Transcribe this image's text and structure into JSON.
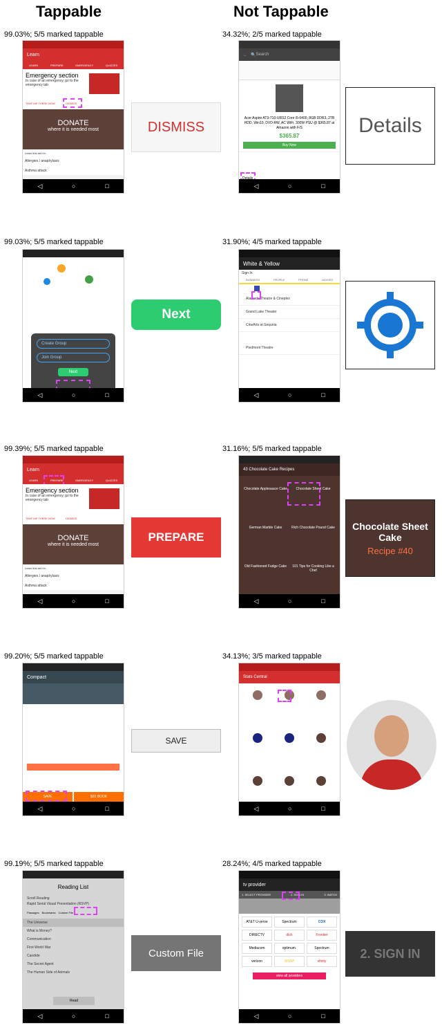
{
  "headers": {
    "tappable": "Tappable",
    "not_tappable": "Not Tappable"
  },
  "rows": [
    {
      "left_caption": "99.03%; 5/5 marked tappable",
      "left_crop": "DISMISS",
      "right_caption": "34.32%; 2/5 marked tappable",
      "right_crop": "Details"
    },
    {
      "left_caption": "99.03%; 5/5 marked tappable",
      "left_crop": "Next",
      "right_caption": "31.90%; 4/5 marked tappable",
      "right_crop": ""
    },
    {
      "left_caption": "99.39%; 5/5 marked tappable",
      "left_crop": "PREPARE",
      "right_caption": "31.16%; 5/5 marked tappable",
      "right_crop_title": "Chocolate Sheet Cake",
      "right_crop_sub": "Recipe #40"
    },
    {
      "left_caption": "99.20%; 5/5 marked tappable",
      "left_crop": "SAVE",
      "right_caption": "34.13%; 3/5 marked tappable",
      "right_crop": ""
    },
    {
      "left_caption": "99.19%; 5/5 marked tappable",
      "left_crop": "Custom File",
      "right_caption": "28.24%; 4/5 marked tappable",
      "right_crop": "2. SIGN IN"
    }
  ],
  "screens": {
    "learn_title": "Learn",
    "learn_tabs": [
      "LEARN",
      "PREPARE",
      "EMERGENCY",
      "QUIZZES"
    ],
    "emergency_section": "Emergency section",
    "emergency_text": "In case of an emergency, go to the emergency tab",
    "take_me": "TAKE ME THERE NOW",
    "dismiss": "DISMISS",
    "donate": "DONATE",
    "donate_sub": "where it is needed most",
    "learn_first_aid": "Learn first aid for...",
    "allergies": "Allergies / anaphylaxis",
    "asthma": "Asthma attack",
    "search": "Search",
    "product_title": "Acer Aspire AT3-710-URS2 Core i5-6400, 8GB DDR3, 2TB HDD, Win10, DVD-RW, AC WiFi, 300W PSU @ $365.87 at Amazon with F/S",
    "price": "$365.87",
    "buy_now": "Buy Now",
    "details": "Details",
    "create_group": "Create Group",
    "join_group": "Join Group",
    "next": "Next",
    "white_yellow": "White & Yellow",
    "sign_in": "Sign In",
    "yp_tabs": [
      "BUSINESS",
      "PEOPLE",
      "PHONE",
      "MOVIES"
    ],
    "theaters": [
      "Alameda Theatre & Cineplex",
      "Grand Lake Theater",
      "CineArts at Sequoia",
      "Piedmont Theatre"
    ],
    "cake_app": "43 Chocolate Cake Recipes",
    "cakes": [
      "Chocolate Applesauce Cake",
      "Chocolate Sheet Cake",
      "German Marble Cake",
      "Rich Chocolate Pound Cake",
      "Old Fashioned Fudge Cake",
      "101 Tips for Cooking Like a Chef"
    ],
    "compact": "Compact",
    "save": "SAVE",
    "book": "$20 BOOK",
    "stats_central": "Stats Central",
    "reading_list": "Reading List",
    "scroll_reading": "Scroll Reading",
    "rsvp": "Rapid Serial Visual Presentation (RSVP)",
    "reading_tabs": [
      "Passages",
      "Bookmarks",
      "Custom File"
    ],
    "books": [
      "The Universe",
      "What is Money?",
      "Communication",
      "First World War",
      "Candide",
      "The Secret Agent",
      "The Human Side of Animals"
    ],
    "read": "Read",
    "tv_provider": "tv provider",
    "select_provider": "1. SELECT PROVIDER",
    "sign_in_step": "2. SIGN IN",
    "watch": "3. WATCH",
    "providers": [
      "AT&T U-verse",
      "Spectrum",
      "COX",
      "DIRECTV",
      "dish",
      "Frontier",
      "Mediacom",
      "optimum.",
      "Spectrum",
      "verizon",
      "WOW!",
      "xfinity"
    ],
    "view_all": "view all providers"
  },
  "colors": {
    "dash": "#e040fb",
    "red": "#d32f2f",
    "green": "#2ecc71"
  }
}
